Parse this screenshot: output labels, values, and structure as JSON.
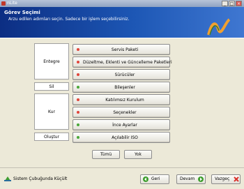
{
  "window": {
    "title": "nLite",
    "min": "_",
    "max": "□",
    "close": "×"
  },
  "header": {
    "title": "Görev Seçimi",
    "subtitle": "Arzu edilen adımları seçin. Sadece bir işlem seçebilirsiniz."
  },
  "groups": {
    "entegre": "Entegre",
    "sil": "Sil",
    "kur": "Kur",
    "olustur": "Oluştur"
  },
  "tasks": [
    {
      "label": "Servis Paketi",
      "state": "red"
    },
    {
      "label": "Düzeltme, Eklenti ve Güncelleme Paketleri",
      "state": "red"
    },
    {
      "label": "Sürücüler",
      "state": "red"
    },
    {
      "label": "Bileşenler",
      "state": "green"
    },
    {
      "label": "Katılımsız Kurulum",
      "state": "red"
    },
    {
      "label": "Seçenekler",
      "state": "red"
    },
    {
      "label": "İnce Ayarlar",
      "state": "green"
    },
    {
      "label": "Açılabilir ISO",
      "state": "green"
    }
  ],
  "select": {
    "all": "Tümü",
    "none": "Yok"
  },
  "footer": {
    "tray": "Sistem Çubuğunda Küçült",
    "back": "Geri",
    "next": "Devam",
    "cancel": "Vazgeç"
  },
  "colors": {
    "red_dot": "#e0463b",
    "green_dot": "#4aa83a",
    "header_bg": "#1d57b5"
  }
}
